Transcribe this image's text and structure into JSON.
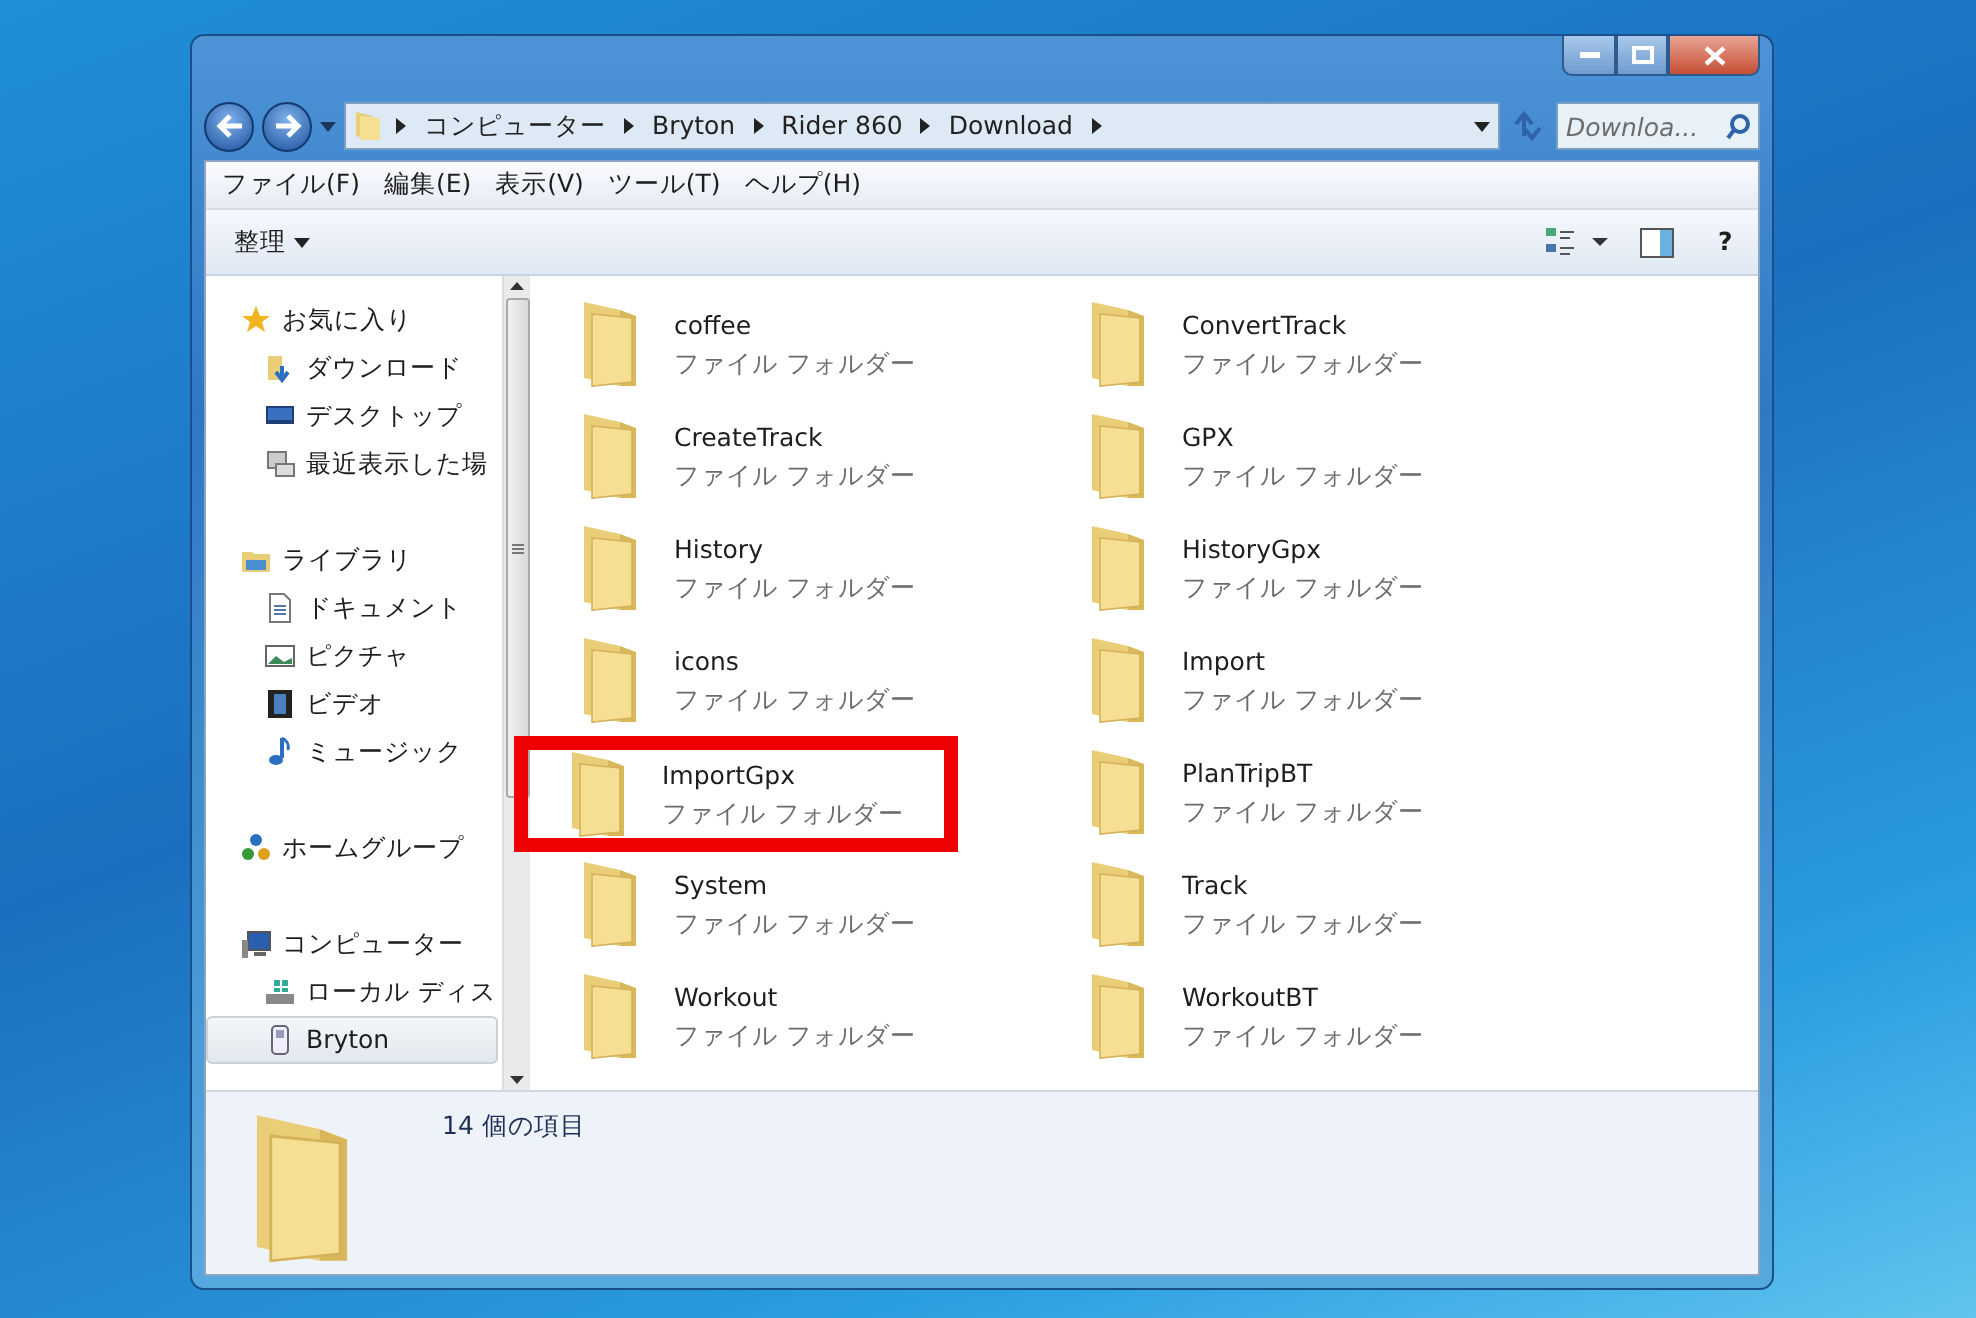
{
  "address": {
    "segments": [
      "コンピューター",
      "Bryton",
      "Rider 860",
      "Download"
    ]
  },
  "search": {
    "placeholder": "Downloa..."
  },
  "menu": [
    "ファイル(F)",
    "編集(E)",
    "表示(V)",
    "ツール(T)",
    "ヘルプ(H)"
  ],
  "toolbar": {
    "organize": "整理",
    "help": "?"
  },
  "navigation": [
    {
      "label": "お気に入り",
      "kind": "star",
      "selected": false,
      "children": [
        {
          "label": "ダウンロード",
          "kind": "download",
          "selected": false
        },
        {
          "label": "デスクトップ",
          "kind": "desktop",
          "selected": false
        },
        {
          "label": "最近表示した場",
          "kind": "recent",
          "selected": false
        }
      ]
    },
    {
      "label": "ライブラリ",
      "kind": "library",
      "selected": false,
      "children": [
        {
          "label": "ドキュメント",
          "kind": "document",
          "selected": false
        },
        {
          "label": "ピクチャ",
          "kind": "picture",
          "selected": false
        },
        {
          "label": "ビデオ",
          "kind": "video",
          "selected": false
        },
        {
          "label": "ミュージック",
          "kind": "music",
          "selected": false
        }
      ]
    },
    {
      "label": "ホームグループ",
      "kind": "homegroup",
      "selected": false
    },
    {
      "label": "コンピューター",
      "kind": "computer",
      "selected": false,
      "children": [
        {
          "label": "ローカル ディス",
          "kind": "disk",
          "selected": false
        },
        {
          "label": "Bryton",
          "kind": "device",
          "selected": true
        }
      ]
    }
  ],
  "items": [
    {
      "name": "coffee",
      "type": "ファイル フォルダー",
      "highlighted": false
    },
    {
      "name": "ConvertTrack",
      "type": "ファイル フォルダー",
      "highlighted": false
    },
    {
      "name": "CreateTrack",
      "type": "ファイル フォルダー",
      "highlighted": false
    },
    {
      "name": "GPX",
      "type": "ファイル フォルダー",
      "highlighted": false
    },
    {
      "name": "History",
      "type": "ファイル フォルダー",
      "highlighted": false
    },
    {
      "name": "HistoryGpx",
      "type": "ファイル フォルダー",
      "highlighted": false
    },
    {
      "name": "icons",
      "type": "ファイル フォルダー",
      "highlighted": false
    },
    {
      "name": "Import",
      "type": "ファイル フォルダー",
      "highlighted": false
    },
    {
      "name": "ImportGpx",
      "type": "ファイル フォルダー",
      "highlighted": true
    },
    {
      "name": "PlanTripBT",
      "type": "ファイル フォルダー",
      "highlighted": false
    },
    {
      "name": "System",
      "type": "ファイル フォルダー",
      "highlighted": false
    },
    {
      "name": "Track",
      "type": "ファイル フォルダー",
      "highlighted": false
    },
    {
      "name": "Workout",
      "type": "ファイル フォルダー",
      "highlighted": false
    },
    {
      "name": "WorkoutBT",
      "type": "ファイル フォルダー",
      "highlighted": false
    }
  ],
  "details": {
    "count": "14 個の項目"
  }
}
